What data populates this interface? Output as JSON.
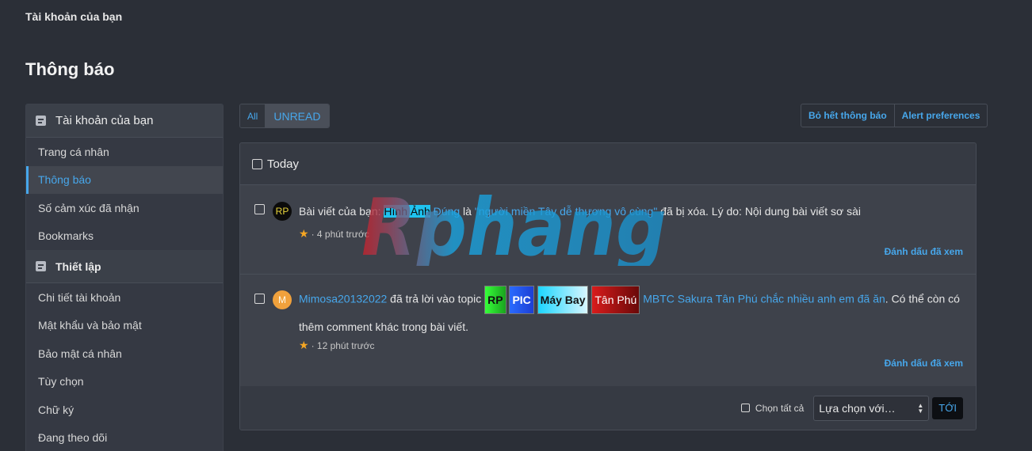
{
  "breadcrumb": "Tài khoản của bạn",
  "page_title": "Thông báo",
  "sidebar": {
    "sections": [
      {
        "title": "Tài khoản của bạn",
        "items": [
          "Trang cá nhân",
          "Thông báo",
          "Số cảm xúc đã nhận",
          "Bookmarks"
        ]
      },
      {
        "title": "Thiết lập",
        "items": [
          "Chi tiết tài khoản",
          "Mật khẩu và bảo mật",
          "Bảo mật cá nhân",
          "Tùy chọn",
          "Chữ ký",
          "Đang theo dõi"
        ]
      }
    ],
    "active_item": "Thông báo"
  },
  "tabs": {
    "all": "All",
    "unread": "UNREAD"
  },
  "top_actions": {
    "dismiss_all": "Bỏ hết thông báo",
    "preferences": "Alert preferences"
  },
  "block": {
    "heading": "Today",
    "alerts": [
      {
        "avatar": "RP",
        "prefix": "Bài viết của bạn: ",
        "highlight": "Hình Ảnh",
        "link1": " Đúng",
        "mid": " là ",
        "link2": "\"người miền Tây dễ thương vô cùng\"",
        "suffix": " đã bị xóa. Lý do: Nội dung bài viết sơ sài",
        "time": "· 4 phút trước",
        "mark_read": "Đánh dấu đã xem"
      },
      {
        "avatar": "M",
        "user": "Mimosa20132022",
        "action": " đã trả lời vào topic ",
        "tags": [
          "RP",
          "PIC",
          "Máy Bay",
          "Tân Phú"
        ],
        "topic": "MBTC Sakura Tân Phú chắc nhiều anh em đã ăn",
        "suffix": ". Có thể còn có thêm comment khác trong bài viết.",
        "time": "· 12 phút trước",
        "mark_read": "Đánh dấu đã xem"
      }
    ],
    "footer": {
      "select_all": "Chọn tất cả",
      "action_placeholder": "Lựa chọn với…",
      "go": "TỚI"
    }
  },
  "watermark": "Rphang",
  "colors": {
    "background": "#2b2f37",
    "accent": "#47a7eb",
    "panel": "#3b3f48"
  }
}
